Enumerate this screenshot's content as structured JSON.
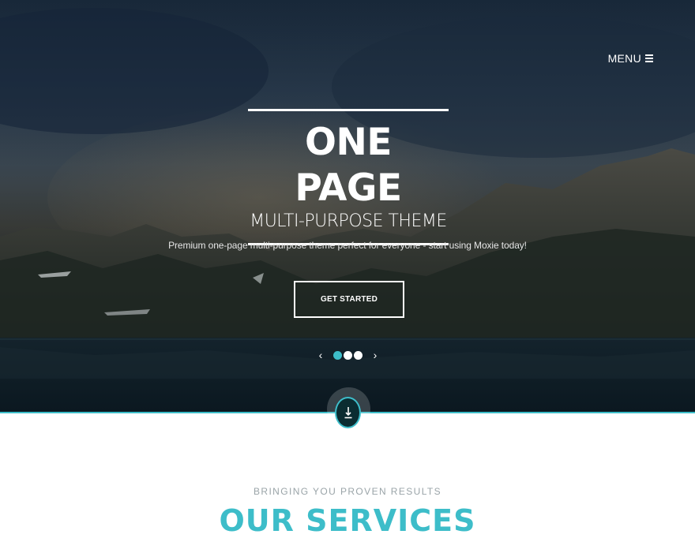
{
  "nav": {
    "menu_label": "MENU",
    "menu_icon": "hamburger-icon"
  },
  "hero": {
    "title": "ONE PAGE",
    "subtitle": "MULTI-PURPOSE THEME",
    "tagline": "Premium one-page multi-purpose theme perfect for everyone - start using Moxie today!",
    "cta_label": "GET STARTED",
    "slider": {
      "prev_icon": "chevron-left-icon",
      "next_icon": "chevron-right-icon",
      "slide_count": 3,
      "active_slide": 1
    },
    "scroll_icon": "arrow-down-icon"
  },
  "services": {
    "eyebrow": "BRINGING YOU PROVEN RESULTS",
    "title": "OUR SERVICES"
  },
  "colors": {
    "accent": "#3dbdc9",
    "hero_dark": "#0c1720",
    "white": "#ffffff"
  }
}
